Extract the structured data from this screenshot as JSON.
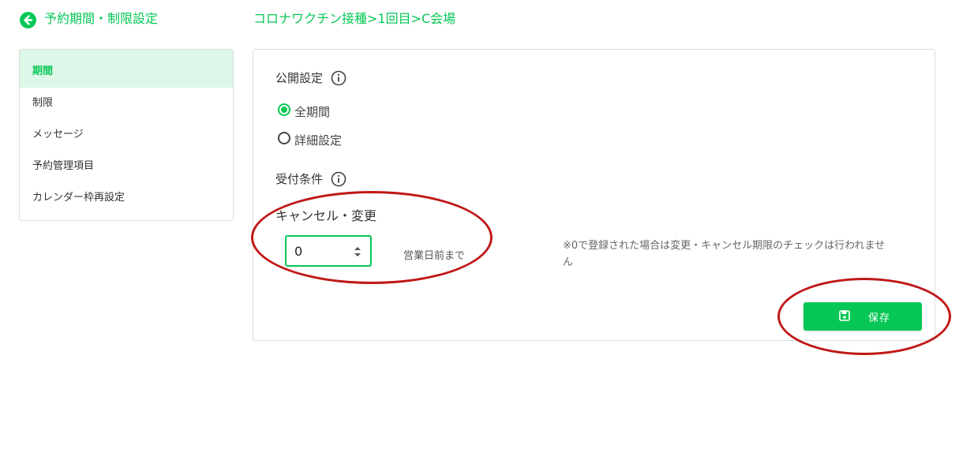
{
  "header": {
    "back_icon": "arrow-left-circle-icon",
    "title": "予約期間・制限設定",
    "breadcrumb": "コロナワクチン接種>1回目>C会場"
  },
  "sidebar": {
    "items": [
      {
        "label": "期間",
        "active": true
      },
      {
        "label": "制限",
        "active": false
      },
      {
        "label": "メッセージ",
        "active": false
      },
      {
        "label": "予約管理項目",
        "active": false
      },
      {
        "label": "カレンダー枠再設定",
        "active": false
      }
    ]
  },
  "main": {
    "publish": {
      "label": "公開設定",
      "info_icon": "info-icon",
      "options": [
        {
          "label": "全期間",
          "selected": true
        },
        {
          "label": "詳細設定",
          "selected": false
        }
      ]
    },
    "acceptance": {
      "label": "受付条件",
      "info_icon": "info-icon",
      "sub_label": "キャンセル・変更",
      "input_value": "0",
      "unit": "営業日前まで",
      "note": "※0で登録された場合は変更・キャンセル期限のチェックは行われません"
    },
    "save_button": {
      "label": "保存",
      "icon": "floppy-disk-icon"
    }
  },
  "colors": {
    "accent": "#06c755",
    "active_bg": "#ddf7e8",
    "annotation": "#c01818"
  }
}
